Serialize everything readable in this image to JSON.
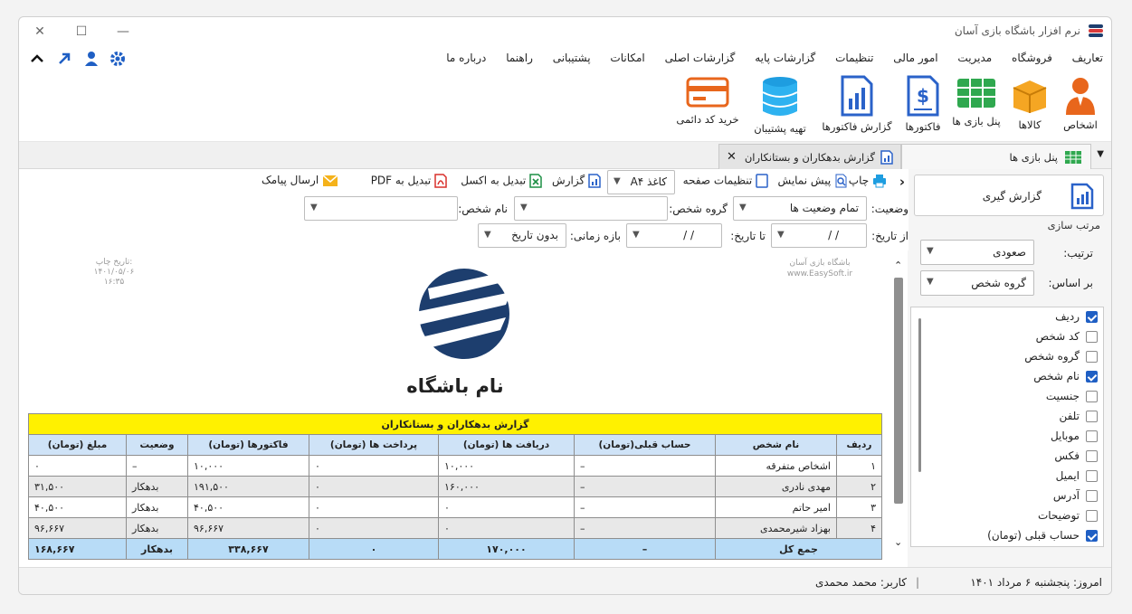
{
  "window": {
    "title": "نرم افزار باشگاه بازی آسان"
  },
  "menu": [
    "تعاریف",
    "فروشگاه",
    "مدیریت",
    "امور مالی",
    "تنظیمات",
    "گزارشات پایه",
    "گزارشات اصلی",
    "امکانات",
    "پشتیبانی",
    "راهنما",
    "درباره ما"
  ],
  "ribbon": {
    "persons": "اشخاص",
    "products": "کالاها",
    "game_panel": "پنل بازی ها",
    "invoices": "فاکتورها",
    "invoice_report": "گزارش فاکتورها",
    "backup": "تهیه پشتیبان",
    "buy_code": "خرید کد دائمی"
  },
  "tabs": [
    {
      "label": "پنل بازی ها"
    },
    {
      "label": "گزارش بدهکاران و بستانکاران"
    }
  ],
  "toolbar": {
    "print": "چاپ",
    "preview": "پیش نمایش",
    "page_settings": "تنظیمات صفحه",
    "paper": "کاغذ A۴",
    "report": "گزارش",
    "excel": "تبدیل به اکسل",
    "pdf": "تبدیل به PDF",
    "sms": "ارسال پیامک"
  },
  "filters": {
    "status_label": "وضعیت:",
    "status_value": "تمام وضعیت ها",
    "group_label": "گروه شخص:",
    "group_value": "",
    "name_label": "نام شخص:",
    "name_value": "",
    "from_label": "از تاریخ:",
    "from_value": "/     /",
    "to_label": "تا تاریخ:",
    "to_value": "/     /",
    "period_label": "بازه زمانی:",
    "period_value": "بدون تاریخ"
  },
  "sidepanel": {
    "report_button": "گزارش گیری",
    "sort_group": "مرتب سازی",
    "order_label": "ترتیب:",
    "order_value": "صعودی",
    "basis_label": "بر اساس:",
    "basis_value": "گروه شخص",
    "columns": [
      {
        "label": "ردیف",
        "checked": true
      },
      {
        "label": "کد شخص",
        "checked": false
      },
      {
        "label": "گروه شخص",
        "checked": false
      },
      {
        "label": "نام شخص",
        "checked": true
      },
      {
        "label": "جنسیت",
        "checked": false
      },
      {
        "label": "تلفن",
        "checked": false
      },
      {
        "label": "موبایل",
        "checked": false
      },
      {
        "label": "فکس",
        "checked": false
      },
      {
        "label": "ایمیل",
        "checked": false
      },
      {
        "label": "آدرس",
        "checked": false
      },
      {
        "label": "توضیحات",
        "checked": false
      },
      {
        "label": "حساب قبلی (تومان)",
        "checked": true
      }
    ]
  },
  "report": {
    "print_date_label": "تاریخ چاپ:",
    "print_date": "۱۴۰۱/۰۵/۰۶",
    "print_time": "۱۶:۳۵",
    "company": "باشگاه بازی آسان",
    "website": "www.EasySoft.ir",
    "club_name": "نام باشگاه",
    "title": "گزارش بدهکاران و بستانکاران",
    "columns": [
      "ردیف",
      "نام شخص",
      "حساب قبلی(تومان)",
      "دریافت ها (تومان)",
      "پرداخت ها (تومان)",
      "فاکتورها (تومان)",
      "وضعیت",
      "مبلغ (تومان)"
    ],
    "rows": [
      [
        "۱",
        "اشخاص متفرقه",
        "–",
        "۱۰,۰۰۰",
        "۰",
        "۱۰,۰۰۰",
        "–",
        "۰"
      ],
      [
        "۲",
        "مهدی نادری",
        "–",
        "۱۶۰,۰۰۰",
        "۰",
        "۱۹۱,۵۰۰",
        "بدهکار",
        "۳۱,۵۰۰"
      ],
      [
        "۳",
        "امیر حاتم",
        "–",
        "۰",
        "۰",
        "۴۰,۵۰۰",
        "بدهکار",
        "۴۰,۵۰۰"
      ],
      [
        "۴",
        "بهزاد شیرمحمدی",
        "–",
        "۰",
        "۰",
        "۹۶,۶۶۷",
        "بدهکار",
        "۹۶,۶۶۷"
      ]
    ],
    "total": [
      "جمع کل",
      "–",
      "۱۷۰,۰۰۰",
      "۰",
      "۳۳۸,۶۶۷",
      "بدهکار",
      "۱۶۸,۶۶۷"
    ]
  },
  "status": {
    "today": "امروز: پنجشنبه ۶ مرداد ۱۴۰۱",
    "user": "کاربر: محمد محمدی"
  },
  "colors": {
    "accent": "#1f5fc4",
    "title_row": "#fff100",
    "header_row": "#cfe3f7",
    "total_row": "#b8dcf7",
    "logo": "#1d3e6e"
  }
}
